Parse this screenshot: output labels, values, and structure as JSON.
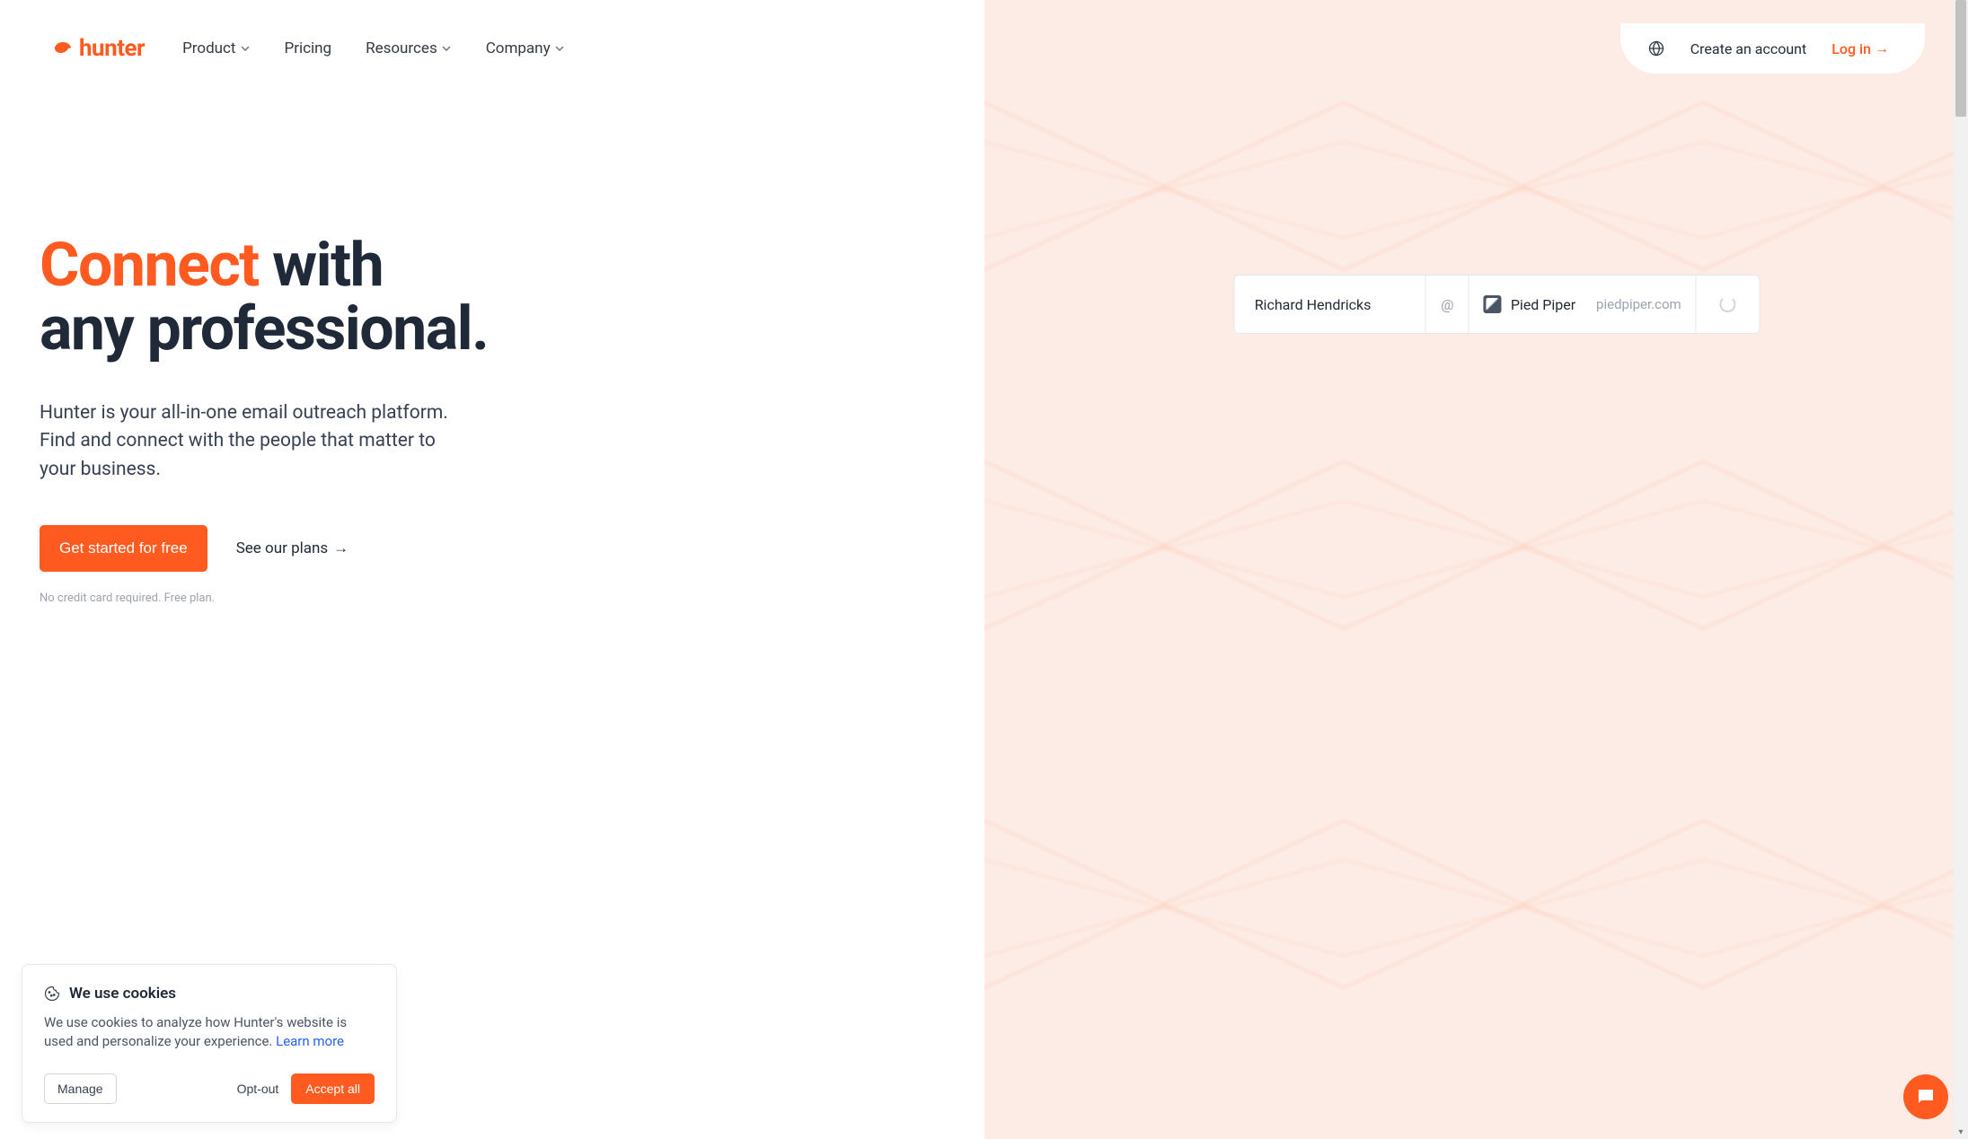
{
  "brand": "hunter",
  "nav": {
    "product": "Product",
    "pricing": "Pricing",
    "resources": "Resources",
    "company": "Company"
  },
  "header": {
    "create_account": "Create an account",
    "login": "Log in"
  },
  "hero": {
    "accent": "Connect",
    "rest_line1": " with",
    "rest_line2": "any professional.",
    "subtitle": "Hunter is your all-in-one email outreach platform. Find and connect with the people that matter to your business.",
    "cta_primary": "Get started for free",
    "cta_secondary": "See our plans",
    "note": "No credit card required. Free plan."
  },
  "finder": {
    "name": "Richard Hendricks",
    "at": "@",
    "company": "Pied Piper",
    "domain": "piedpiper.com"
  },
  "cookies": {
    "title": "We use cookies",
    "text": "We use cookies to analyze how Hunter's website is used and personalize your experience. ",
    "learn_more": "Learn more",
    "manage": "Manage",
    "optout": "Opt-out",
    "accept": "Accept all"
  }
}
